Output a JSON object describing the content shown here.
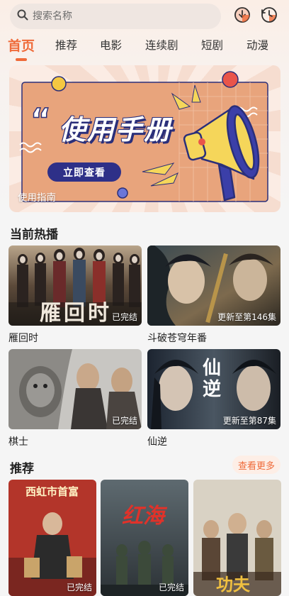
{
  "search": {
    "placeholder": "搜索名称"
  },
  "header": {
    "download_icon": "download-icon",
    "history_icon": "history-icon"
  },
  "tabs": [
    {
      "label": "首页",
      "active": true
    },
    {
      "label": "推荐"
    },
    {
      "label": "电影"
    },
    {
      "label": "连续剧"
    },
    {
      "label": "短剧"
    },
    {
      "label": "动漫"
    }
  ],
  "banner": {
    "title": "使用手册",
    "cta": "立即查看",
    "caption": "使用指南"
  },
  "now_playing": {
    "heading": "当前热播",
    "items": [
      {
        "title": "雁回时",
        "badge": "已完结",
        "poster_text": "雁回时"
      },
      {
        "title": "斗破苍穹年番",
        "badge": "更新至第146集"
      },
      {
        "title": "棋士",
        "badge": "已完结"
      },
      {
        "title": "仙逆",
        "badge": "更新至第87集",
        "poster_text": "仙逆"
      }
    ]
  },
  "recommend": {
    "heading": "推荐",
    "more": "查看更多",
    "items": [
      {
        "badge": "已完结",
        "poster_text": "西虹市首富"
      },
      {
        "badge": "已完结",
        "poster_text": "红海"
      },
      {
        "badge": "",
        "poster_text": "功夫"
      }
    ]
  },
  "colors": {
    "accent": "#ef6b3a",
    "banner_cta": "#2e3088"
  }
}
